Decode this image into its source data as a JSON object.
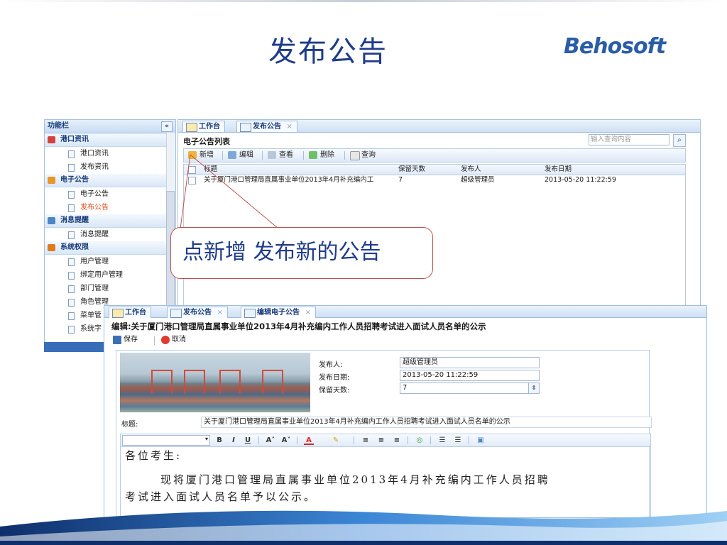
{
  "slide": {
    "title": "发布公告",
    "logo": "Behosoft"
  },
  "sidebar": {
    "header": "功能栏",
    "collapse_glyph": "«",
    "groups": [
      {
        "label": "港口资讯",
        "color": "#d8413a",
        "items": [
          {
            "label": "港口资讯"
          },
          {
            "label": "发布资讯"
          }
        ]
      },
      {
        "label": "电子公告",
        "color": "#e8952a",
        "items": [
          {
            "label": "电子公告"
          },
          {
            "label": "发布公告"
          }
        ]
      },
      {
        "label": "消息提醒",
        "color": "#4b86c8",
        "items": [
          {
            "label": "消息提醒"
          }
        ]
      },
      {
        "label": "系统权限",
        "color": "#e07a1c",
        "items": [
          {
            "label": "用户管理"
          },
          {
            "label": "绑定用户管理"
          },
          {
            "label": "部门管理"
          },
          {
            "label": "角色管理"
          },
          {
            "label": "菜单管"
          },
          {
            "label": "系统字"
          }
        ]
      }
    ]
  },
  "main": {
    "tabs": [
      {
        "label": "工作台"
      },
      {
        "label": "发布公告"
      }
    ],
    "close_glyph": "×",
    "pane_title": "电子公告列表",
    "search": {
      "placeholder": "输入查询内容"
    },
    "toolbar": {
      "add": "新增",
      "edit": "编辑",
      "view": "查看",
      "delete": "删除",
      "query": "查询"
    },
    "grid": {
      "columns": [
        "标题",
        "保留天数",
        "发布人",
        "发布日期"
      ],
      "rows": [
        {
          "title": "关于厦门港口管理局直属事业单位2013年4月补充编内工",
          "days": "7",
          "publisher": "超级管理员",
          "date": "2013-05-20 11:22:59"
        }
      ]
    }
  },
  "callout": {
    "text": "点新增 发布新的公告",
    "border_color": "#c0504d"
  },
  "editor_window": {
    "tabs": [
      {
        "label": "工作台"
      },
      {
        "label": "发布公告"
      },
      {
        "label": "编辑电子公告"
      }
    ],
    "title": "编辑:关于厦门港口管理局直属事业单位2013年4月补充编内工作人员招聘考试进入面试人员名单的公示",
    "toolbar": {
      "save": "保存",
      "cancel": "取消"
    },
    "form": {
      "publisher_label": "发布人:",
      "publisher_value": "超级管理员",
      "date_label": "发布日期:",
      "date_value": "2013-05-20 11:22:59",
      "days_label": "保留天数:",
      "days_value": "7",
      "title_label": "标题:",
      "title_value": "关于厦门港口管理局直属事业单位2013年4月补充编内工作人员招聘考试进入面试人员名单的公示"
    },
    "editor_toolbar": {
      "bold": "B",
      "italic": "I",
      "underline": "U",
      "font_up": "A˄",
      "font_down": "A˅",
      "font_color": "A",
      "dropdown": "▾"
    },
    "body": {
      "greeting": "各位考生:",
      "line1": "现将厦门港口管理局直属事业单位2013年4月补充编内工作人员招聘",
      "line2": "考试进入面试人员名单予以公示。"
    }
  }
}
